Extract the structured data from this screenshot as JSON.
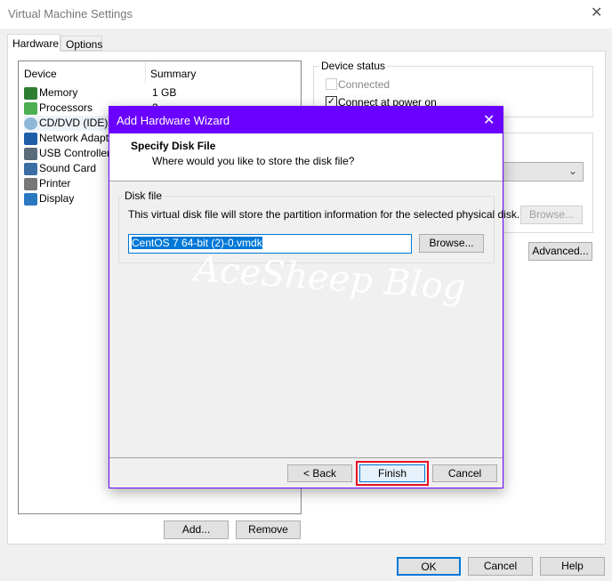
{
  "window": {
    "title": "Virtual Machine Settings"
  },
  "tabs": [
    {
      "label": "Hardware",
      "active": true
    },
    {
      "label": "Options",
      "active": false
    }
  ],
  "device_list": {
    "columns": [
      "Device",
      "Summary"
    ],
    "rows": [
      {
        "device": "Memory",
        "summary": "1 GB",
        "icon": "memory-icon"
      },
      {
        "device": "Processors",
        "summary": "2",
        "icon": "processor-icon"
      },
      {
        "device": "CD/DVD (IDE)",
        "summary": "",
        "icon": "cd-icon"
      },
      {
        "device": "Network Adapter",
        "summary": "",
        "icon": "network-icon"
      },
      {
        "device": "USB Controller",
        "summary": "",
        "icon": "usb-icon"
      },
      {
        "device": "Sound Card",
        "summary": "",
        "icon": "sound-icon"
      },
      {
        "device": "Printer",
        "summary": "",
        "icon": "printer-icon"
      },
      {
        "device": "Display",
        "summary": "",
        "icon": "display-icon"
      }
    ]
  },
  "list_buttons": {
    "add": "Add...",
    "remove": "Remove"
  },
  "device_status": {
    "title": "Device status",
    "connected": "Connected",
    "connected_checked": false,
    "connect_power": "Connect at power on",
    "connect_power_checked": true
  },
  "right": {
    "browse": "Browse...",
    "advanced": "Advanced..."
  },
  "footer": {
    "ok": "OK",
    "cancel": "Cancel",
    "help": "Help"
  },
  "wizard": {
    "title": "Add Hardware Wizard",
    "heading": "Specify Disk File",
    "subheading": "Where would you like to store the disk file?",
    "group": "Disk file",
    "description": "This virtual disk file will store the partition information for the selected physical disk.",
    "file_value": "CentOS 7 64-bit (2)-0.vmdk",
    "browse": "Browse...",
    "back": "< Back",
    "finish": "Finish",
    "cancel": "Cancel",
    "accent": "#6a00ff",
    "highlight": "#e81123"
  },
  "watermark": "AceSheep Blog"
}
